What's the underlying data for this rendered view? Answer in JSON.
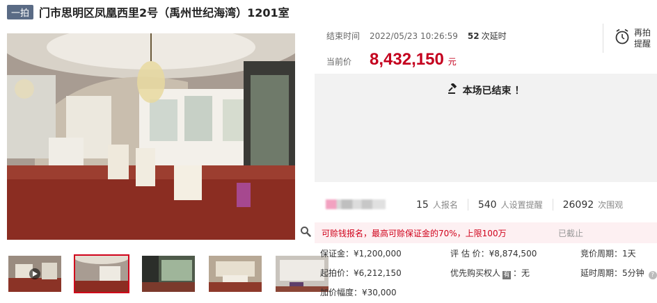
{
  "header": {
    "badge": "一拍",
    "title": "门市思明区凤凰西里2号（禹州世纪海湾）1201室"
  },
  "auction": {
    "end_label": "结束时间",
    "end_time": "2022/05/23 10:26:59",
    "delay_count": "52",
    "delay_label": "次延时",
    "remind_label": "再拍提醒",
    "price_label": "当前价",
    "price": "8,432,150",
    "price_unit": "元",
    "ended_text": "本场已结束 ！"
  },
  "stats": [
    {
      "num": "15",
      "text": "人报名"
    },
    {
      "num": "540",
      "text": "人设置提醒"
    },
    {
      "num": "26092",
      "text": "次围观"
    }
  ],
  "notice": {
    "message": "可赊钱报名，最高可赊保证金的70%，上限100万",
    "status": "已截止"
  },
  "info": {
    "deposit": "保证金：¥1,200,000",
    "valuation": "评 估 价：¥8,874,500",
    "bid_cycle": "竞价周期：1天",
    "start_price": "起拍价：¥6,212,150",
    "priority_label": "优先购买权人",
    "priority_tag": "有",
    "priority_value": "：无",
    "delay_cycle": "延时周期：5分钟",
    "increment": "加价幅度：¥30,000"
  },
  "colors": {
    "accent": "#c4001e",
    "badge": "#5a6b85",
    "notice_bg": "#fdf0f2"
  }
}
